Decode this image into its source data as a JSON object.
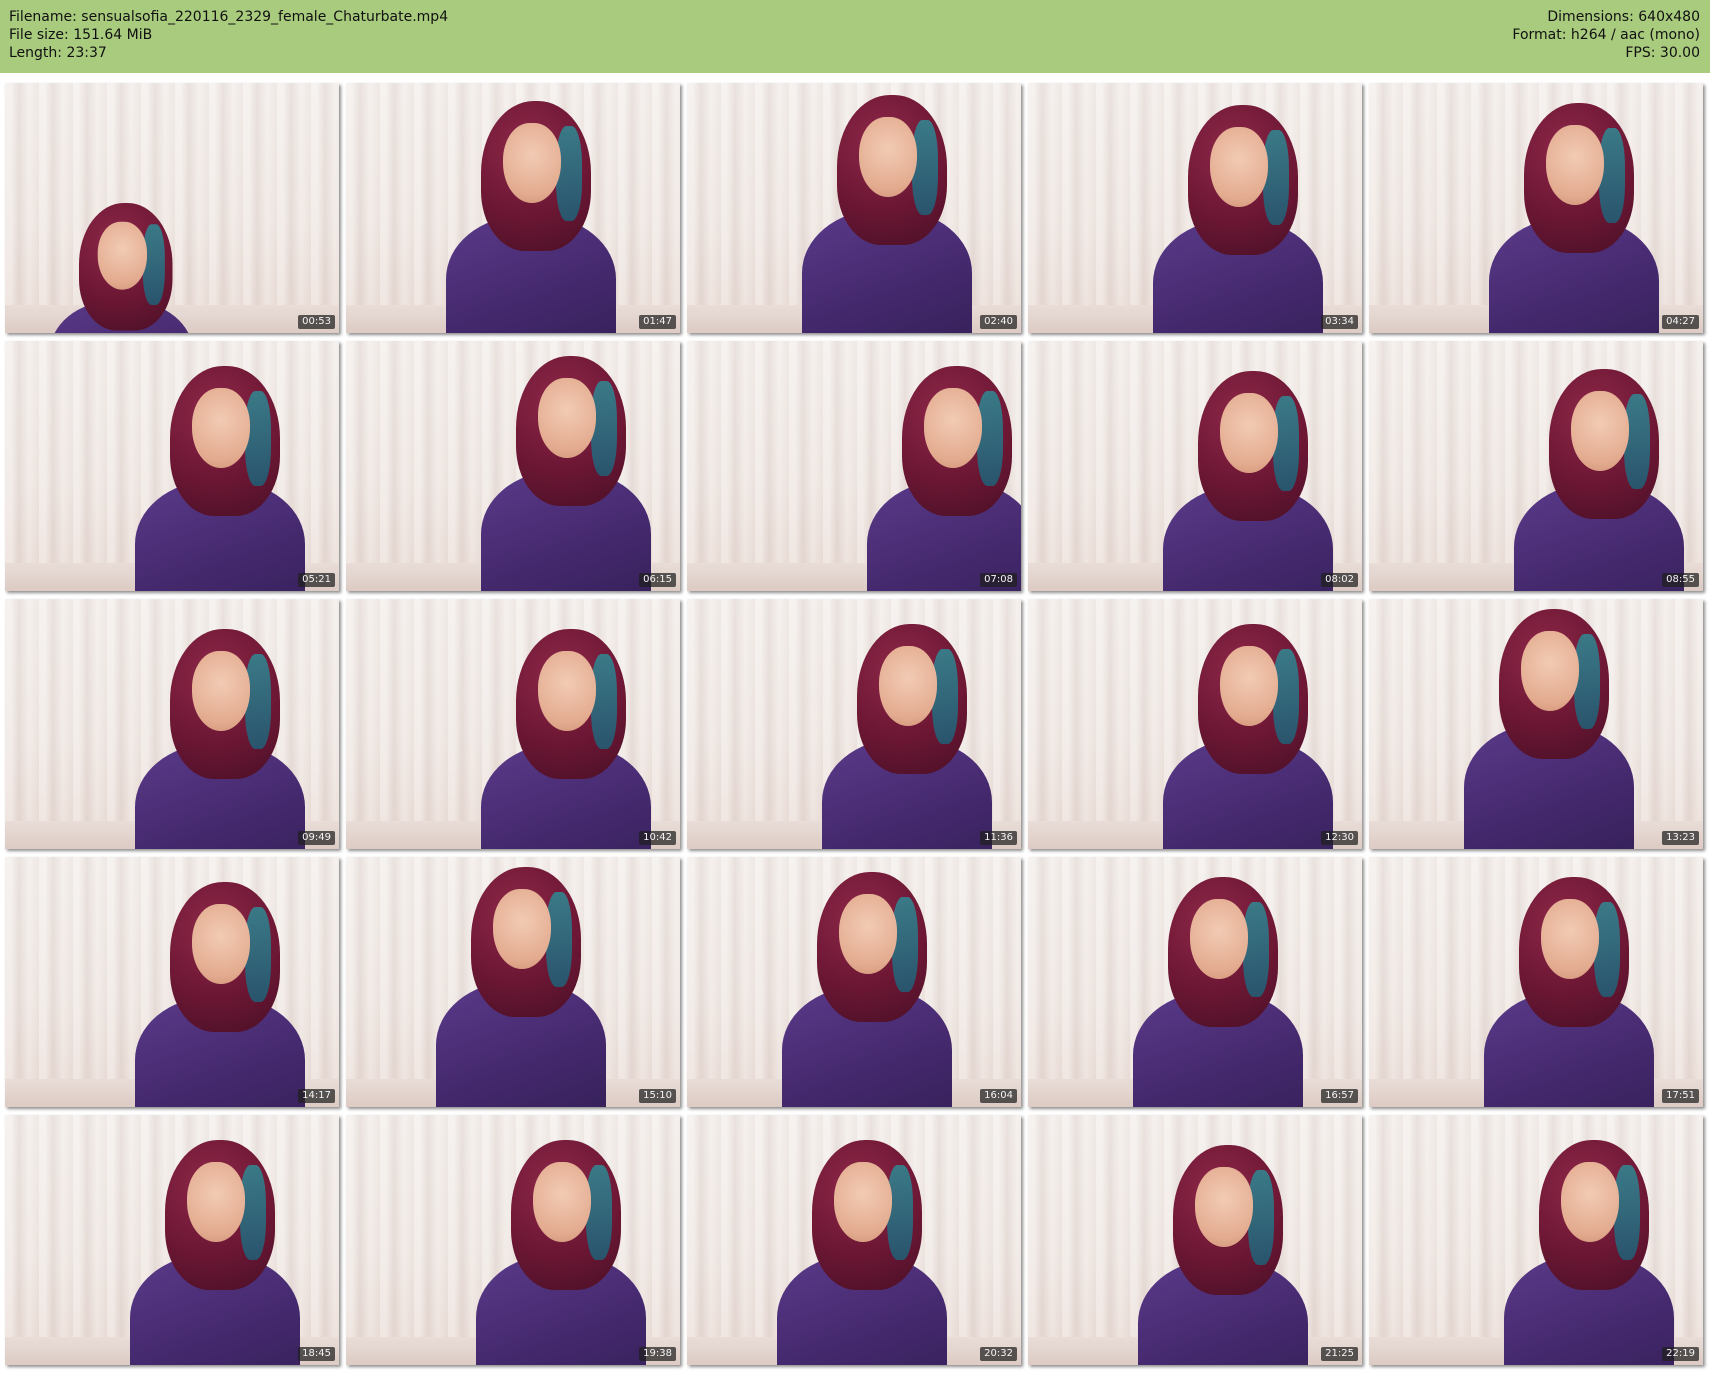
{
  "header": {
    "filename_line": "Filename: sensualsofia_220116_2329_female_Chaturbate.mp4",
    "filesize_line": "File size: 151.64 MiB",
    "length_line": "Length: 23:37",
    "dimensions_line": "Dimensions: 640x480",
    "format_line": "Format: h264 / aac (mono)",
    "fps_line": "FPS: 30.00",
    "background_color": "#a9cb7e"
  },
  "thumbnails": [
    {
      "time": "00:53"
    },
    {
      "time": "01:47"
    },
    {
      "time": "02:40"
    },
    {
      "time": "03:34"
    },
    {
      "time": "04:27"
    },
    {
      "time": "05:21"
    },
    {
      "time": "06:15"
    },
    {
      "time": "07:08"
    },
    {
      "time": "08:02"
    },
    {
      "time": "08:55"
    },
    {
      "time": "09:49"
    },
    {
      "time": "10:42"
    },
    {
      "time": "11:36"
    },
    {
      "time": "12:30"
    },
    {
      "time": "13:23"
    },
    {
      "time": "14:17"
    },
    {
      "time": "15:10"
    },
    {
      "time": "16:04"
    },
    {
      "time": "16:57"
    },
    {
      "time": "17:51"
    },
    {
      "time": "18:45"
    },
    {
      "time": "19:38"
    },
    {
      "time": "20:32"
    },
    {
      "time": "21:25"
    },
    {
      "time": "22:19"
    }
  ]
}
